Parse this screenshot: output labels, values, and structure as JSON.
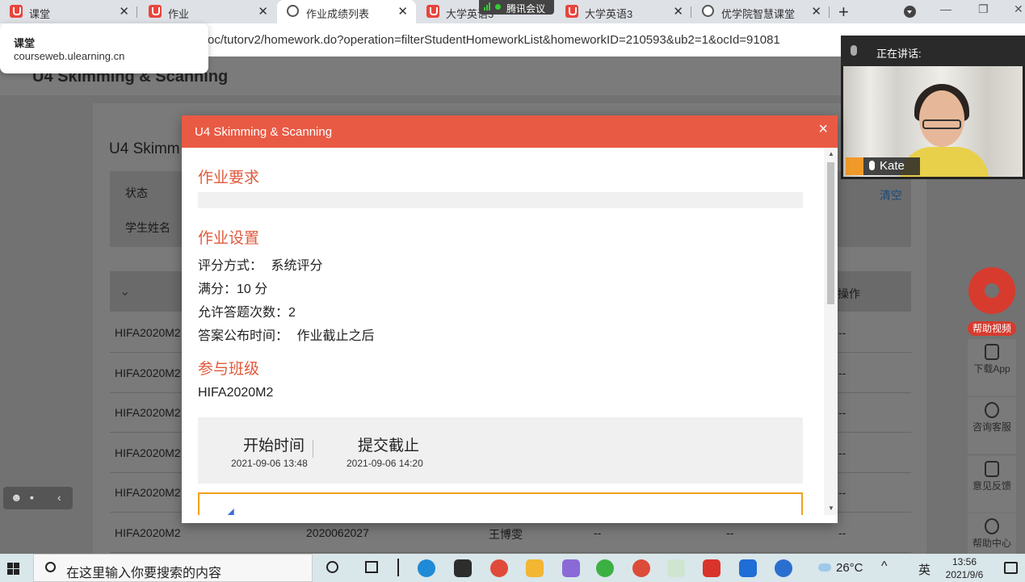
{
  "browser": {
    "tabs": [
      {
        "label": "课堂",
        "icon": "ulearning-icon"
      },
      {
        "label": "作业",
        "icon": "ulearning-icon"
      },
      {
        "label": "作业成绩列表",
        "icon": "globe-icon"
      },
      {
        "label": "大学英语3",
        "icon": "ulearning-icon"
      },
      {
        "label": "大学英语3",
        "icon": "ulearning-icon"
      },
      {
        "label": "优学院智慧课堂",
        "icon": "globe-icon"
      }
    ],
    "url": "oc/tutorv2/homework.do?operation=filterStudentHomeworkList&homeworkID=210593&ub2=1&ocId=91081",
    "tooltip_title": "课堂",
    "tooltip_domain": "courseweb.ulearning.cn",
    "meeting_badge": "腾讯会议"
  },
  "page": {
    "header_title": "U4 Skimming & Scanning",
    "card_title": "U4 Skimm",
    "filter_status_label": "状态",
    "filter_student_label": "学生姓名",
    "clear_label": "清空",
    "col_operation": "操作",
    "rows": [
      {
        "c1": "HIFA2020M2",
        "c2": "",
        "c3": "",
        "c4": "",
        "c5": "",
        "c6": "--"
      },
      {
        "c1": "HIFA2020M2",
        "c2": "",
        "c3": "",
        "c4": "",
        "c5": "",
        "c6": "--"
      },
      {
        "c1": "HIFA2020M2",
        "c2": "",
        "c3": "",
        "c4": "",
        "c5": "",
        "c6": "--"
      },
      {
        "c1": "HIFA2020M2",
        "c2": "",
        "c3": "",
        "c4": "",
        "c5": "",
        "c6": "--"
      },
      {
        "c1": "HIFA2020M2",
        "c2": "",
        "c3": "",
        "c4": "",
        "c5": "",
        "c6": "--"
      },
      {
        "c1": "HIFA2020M2",
        "c2": "2020062027",
        "c3": "王博雯",
        "c4": "--",
        "c5": "--",
        "c6": "--"
      }
    ]
  },
  "rail": {
    "help_video": "帮助视频",
    "download_app": "下载App",
    "consult": "咨询客服",
    "feedback": "意见反馈",
    "help_center": "帮助中心"
  },
  "video": {
    "speaking_label": "正在讲话:",
    "name": "Kate"
  },
  "modal": {
    "title": "U4 Skimming & Scanning",
    "close": "×",
    "sec_requirement": "作业要求",
    "sec_settings": "作业设置",
    "grading_label": "评分方式：",
    "grading_value": "系统评分",
    "full_score": "满分：10 分",
    "attempts": "允许答题次数：2",
    "answer_publish_label": "答案公布时间：",
    "answer_publish_value": "作业截止之后",
    "sec_classes": "参与班级",
    "class_name": "HIFA2020M2",
    "start_label": "开始时间",
    "start_value": "2021-09-06 13:48",
    "deadline_label": "提交截止",
    "deadline_value": "2021-09-06 14:20"
  },
  "taskbar": {
    "search_placeholder": "在这里输入你要搜索的内容",
    "weather": "26°C",
    "ime": "英",
    "time": "13:56",
    "date": "2021/9/6"
  },
  "colors": {
    "accent": "#e95a44",
    "section_title": "#e05a3c",
    "tencent_meeting": "#444444"
  }
}
